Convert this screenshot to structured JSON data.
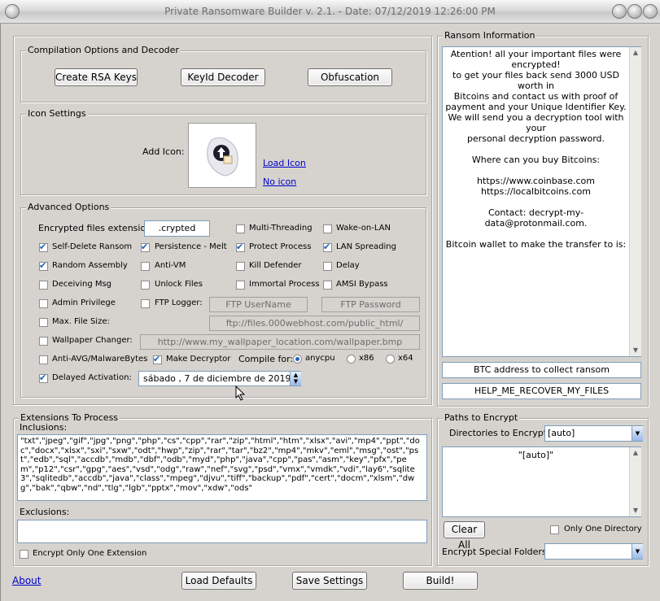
{
  "window": {
    "title": "Private Ransomware Builder v. 2.1. - Date: 07/12/2019 12:26:00 PM"
  },
  "compilation": {
    "title": "Compilation Options and Decoder",
    "buttons": [
      "Create RSA Keys",
      "KeyId Decoder",
      "Obfuscation"
    ]
  },
  "icon_settings": {
    "title": "Icon Settings",
    "add_icon_label": "Add Icon:",
    "load_icon": "Load Icon",
    "no_icon": "No icon"
  },
  "advanced": {
    "title": "Advanced Options",
    "ext_label": "Encrypted files extension:",
    "ext_value": ".crypted",
    "options": {
      "multi_threading": {
        "label": "Multi-Threading",
        "checked": false
      },
      "wake_on_lan": {
        "label": "Wake-on-LAN",
        "checked": false
      },
      "self_delete": {
        "label": "Self-Delete Ransom",
        "checked": true
      },
      "persistence": {
        "label": "Persistence - Melt",
        "checked": true
      },
      "protect_process": {
        "label": "Protect Process",
        "checked": true
      },
      "lan_spreading": {
        "label": "LAN Spreading",
        "checked": true
      },
      "random_assembly": {
        "label": "Random Assembly",
        "checked": true
      },
      "anti_vm": {
        "label": "Anti-VM",
        "checked": false
      },
      "kill_defender": {
        "label": "Kill Defender",
        "checked": false
      },
      "delay": {
        "label": "Delay",
        "checked": false
      },
      "deceiving_msg": {
        "label": "Deceiving Msg",
        "checked": false
      },
      "unlock_files": {
        "label": "Unlock Files",
        "checked": false
      },
      "immortal_process": {
        "label": "Immortal Process",
        "checked": false
      },
      "amsi_bypass": {
        "label": "AMSI Bypass",
        "checked": false
      },
      "admin_privilege": {
        "label": "Admin Privilege",
        "checked": false
      },
      "ftp_logger": {
        "label": "FTP Logger:",
        "checked": false
      },
      "max_file_size": {
        "label": "Max. File Size:",
        "checked": false
      },
      "wallpaper_changer": {
        "label": "Wallpaper Changer:",
        "checked": false
      },
      "anti_av": {
        "label": "Anti-AVG/MalwareBytes",
        "checked": false
      },
      "make_decryptor": {
        "label": "Make Decryptor",
        "checked": true
      },
      "delayed_activation": {
        "label": "Delayed Activation:",
        "checked": true
      }
    },
    "ftp_user_placeholder": "FTP UserName",
    "ftp_password_placeholder": "FTP Password",
    "ftp_url_placeholder": "ftp://files.000webhost.com/public_html/",
    "wallpaper_url_placeholder": "http://www.my_wallpaper_location.com/wallpaper.bmp",
    "compile_for_label": "Compile for:",
    "compile_options": [
      {
        "label": "anycpu",
        "checked": true
      },
      {
        "label": "x86",
        "checked": false
      },
      {
        "label": "x64",
        "checked": false
      }
    ],
    "date_value": "sábado ,  7 de  diciembre  de 2019"
  },
  "ransom_info": {
    "title": "Ransom Information",
    "message": "Atention! all your important files were encrypted!\nto get your files back send 3000 USD worth in\nBitcoins and contact us with proof of\npayment and your Unique Identifier Key.\nWe will send you a decryption tool with your\npersonal decryption password.\n\nWhere can you buy Bitcoins:\n\nhttps://www.coinbase.com\nhttps://localbitcoins.com\n\nContact: decrypt-my-data@protonmail.com.\n\nBitcoin wallet to make the transfer to is:",
    "btc_address": "BTC address to collect ransom",
    "recover_filename": "HELP_ME_RECOVER_MY_FILES"
  },
  "extensions": {
    "title": "Extensions To Process",
    "inclusions_label": "Inclusions:",
    "inclusions": "\"txt\",\"jpeg\",\"gif\",\"jpg\",\"png\",\"php\",\"cs\",\"cpp\",\"rar\",\"zip\",\"html\",\"htm\",\"xlsx\",\"avi\",\"mp4\",\"ppt\",\"doc\",\"docx\",\"xlsx\",\"sxi\",\"sxw\",\"odt\",\"hwp\",\"zip\",\"rar\",\"tar\",\"bz2\",\"mp4\",\"mkv\",\"eml\",\"msg\",\"ost\",\"pst\",\"edb\",\"sql\",\"accdb\",\"mdb\",\"dbf\",\"odb\",\"myd\",\"php\",\"java\",\"cpp\",\"pas\",\"asm\",\"key\",\"pfx\",\"pem\",\"p12\",\"csr\",\"gpg\",\"aes\",\"vsd\",\"odg\",\"raw\",\"nef\",\"svg\",\"psd\",\"vmx\",\"vmdk\",\"vdi\",\"lay6\",\"sqlite3\",\"sqlitedb\",\"accdb\",\"java\",\"class\",\"mpeg\",\"djvu\",\"tiff\",\"backup\",\"pdf\",\"cert\",\"docm\",\"xlsm\",\"dwg\",\"bak\",\"qbw\",\"nd\",\"tlg\",\"lgb\",\"pptx\",\"mov\",\"xdw\",\"ods\"",
    "exclusions_label": "Exclusions:",
    "exclusions": "",
    "encrypt_one_ext": {
      "label": "Encrypt Only One Extension",
      "checked": false
    }
  },
  "paths": {
    "title": "Paths to Encrypt",
    "dirs_label": "Directories to Encrypt:",
    "dirs_value": "[auto]",
    "list_items": [
      "\"[auto]\""
    ],
    "clear_all": "Clear All",
    "only_one_dir": {
      "label": "Only One Directory",
      "checked": false
    },
    "special_folders_label": "Encrypt Special Folders:",
    "special_folders_value": ""
  },
  "footer": {
    "about": "About",
    "load_defaults": "Load Defaults",
    "save_settings": "Save Settings",
    "build": "Build!"
  }
}
